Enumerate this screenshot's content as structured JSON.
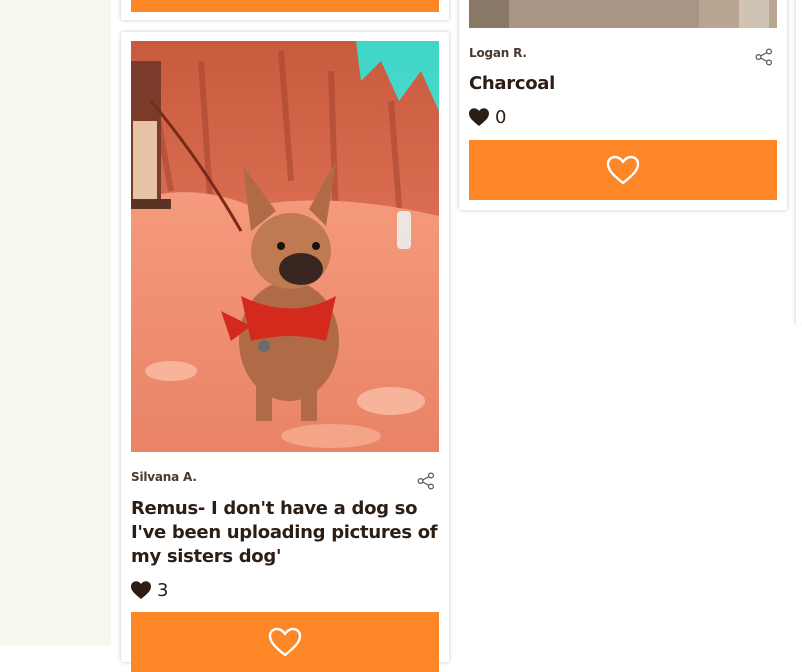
{
  "colors": {
    "accent": "#fd8627",
    "text": "#2c1d15",
    "gutter": "#f9f8f0"
  },
  "cards": {
    "remus": {
      "author": "Silvana A.",
      "title_lines": [
        "Remus- I don't have a dog so",
        "I've been uploading pictures of",
        "my sisters dog'"
      ],
      "likes": "3"
    },
    "charcoal": {
      "author": "Logan R.",
      "title": "Charcoal",
      "likes": "0"
    }
  },
  "icons": {
    "share": "share-icon",
    "heart_filled": "heart-filled-icon",
    "heart_outline": "heart-outline-icon"
  }
}
